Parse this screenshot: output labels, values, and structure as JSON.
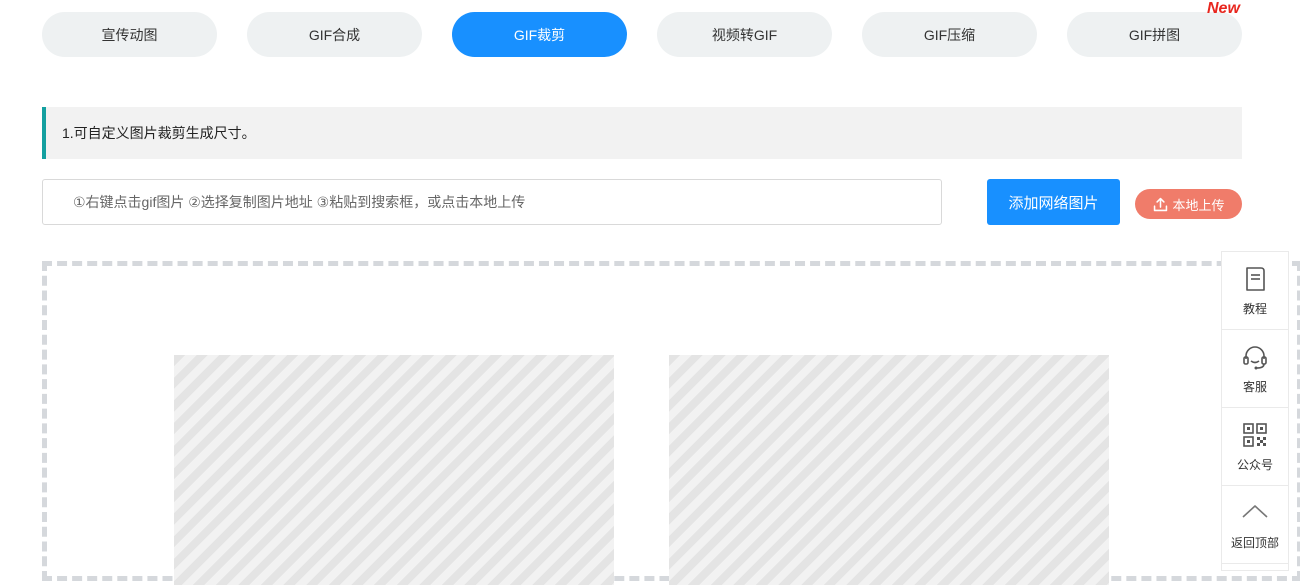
{
  "tabs": [
    {
      "label": "宣传动图",
      "active": false
    },
    {
      "label": "GIF合成",
      "active": false
    },
    {
      "label": "GIF裁剪",
      "active": true
    },
    {
      "label": "视频转GIF",
      "active": false
    },
    {
      "label": "GIF压缩",
      "active": false
    },
    {
      "label": "GIF拼图",
      "active": false
    }
  ],
  "new_badge": "New",
  "notice": {
    "text": "1.可自定义图片裁剪生成尺寸。"
  },
  "url_input": {
    "value": "",
    "placeholder": "①右键点击gif图片 ②选择复制图片地址 ③粘贴到搜索框，或点击本地上传"
  },
  "add_button": {
    "label": "添加网络图片"
  },
  "upload_button": {
    "label": "本地上传",
    "icon": "upload-icon"
  },
  "sidebar": {
    "items": [
      {
        "label": "教程",
        "icon": "document-icon"
      },
      {
        "label": "客服",
        "icon": "headset-icon"
      },
      {
        "label": "公众号",
        "icon": "qrcode-icon"
      },
      {
        "label": "返回顶部",
        "icon": "chevron-up-icon"
      }
    ]
  },
  "colors": {
    "accent": "#1890ff",
    "tab_bg": "#eef1f2",
    "upload": "#f07c6a",
    "notice_border": "#14a0a0",
    "new_badge": "#e8261e"
  }
}
